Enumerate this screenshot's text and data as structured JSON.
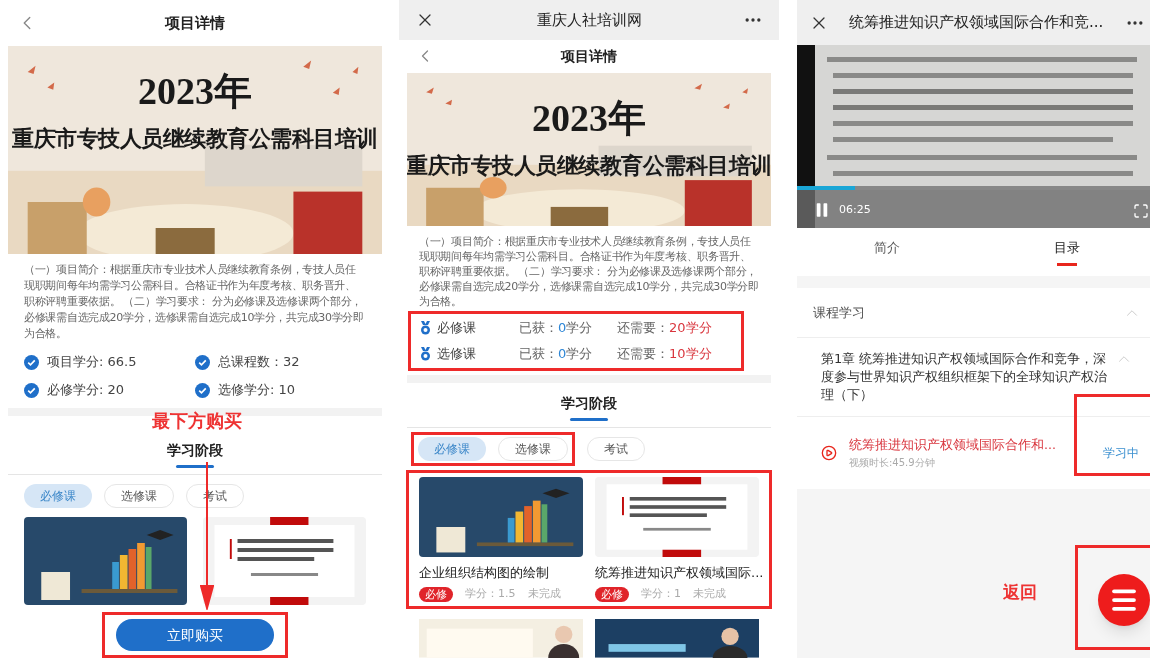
{
  "screen_1": {
    "header_title": "项目详情",
    "banner": {
      "year": "2023年",
      "title": "重庆市专技人员继续教育公需科目培训"
    },
    "description": "（一）项目简介：根据重庆市专业技术人员继续教育条例，专技人员任现职期间每年均需学习公需科目。合格证书作为年度考核、职务晋升、职称评聘重要依据。 （二）学习要求： 分为必修课及选修课两个部分，必修课需自选完成20学分，选修课需自选完成10学分，共完成30学分即为合格。",
    "stats": [
      "项目学分: 66.5",
      "总课程数：32",
      "必修学分: 20",
      "选修学分: 10"
    ],
    "annotation": "最下方购买",
    "section_title": "学习阶段",
    "filters": [
      {
        "label": "必修课",
        "selected": true
      },
      {
        "label": "选修课",
        "selected": false
      },
      {
        "label": "考试",
        "selected": false
      }
    ],
    "buy_button": "立即购买"
  },
  "screen_2": {
    "app_bar_title": "重庆人社培训网",
    "header_title": "项目详情",
    "banner": {
      "year": "2023年",
      "title": "重庆市专技人员继续教育公需科目培训"
    },
    "description": "（一）项目简介：根据重庆市专业技术人员继续教育条例，专技人员任现职期间每年均需学习公需科目。合格证书作为年度考核、职务晋升、职称评聘重要依据。 （二）学习要求： 分为必修课及选修课两个部分，必修课需自选完成20学分，选修课需自选完成10学分，共完成30学分即为合格。",
    "credits": [
      {
        "name": "必修课",
        "earned_label": "已获：",
        "earned": "0",
        "earned_unit": "学分",
        "need_label": "还需要：",
        "need": "20学分"
      },
      {
        "name": "选修课",
        "earned_label": "已获：",
        "earned": "0",
        "earned_unit": "学分",
        "need_label": "还需要：",
        "need": "10学分"
      }
    ],
    "section_title": "学习阶段",
    "filters": [
      {
        "label": "必修课",
        "selected": true
      },
      {
        "label": "选修课",
        "selected": false
      },
      {
        "label": "考试",
        "selected": false
      }
    ],
    "courses": [
      {
        "title": "企业组织结构图的绘制",
        "tag": "必修",
        "credit": "学分：1.5",
        "status": "未完成"
      },
      {
        "title": "统筹推进知识产权领域国际...",
        "tag": "必修",
        "credit": "学分：1",
        "status": "未完成"
      }
    ]
  },
  "screen_3": {
    "title": "统筹推进知识产权领域国际合作和竞...",
    "video": {
      "time": "06:25",
      "level": 0.16,
      "playing": true
    },
    "tabs": [
      {
        "label": "简介",
        "selected": false
      },
      {
        "label": "目录",
        "selected": true
      }
    ],
    "section": {
      "title": "课程学习",
      "expanded": true
    },
    "chapter": {
      "title": "第1章 统筹推进知识产权领域国际合作和竞争，深度参与世界知识产权组织框架下的全球知识产权治理（下）",
      "expanded": true
    },
    "lesson": {
      "title": "统筹推进知识产权领域国际合作和...",
      "duration": "视频时长:45.9分钟",
      "status": "学习中"
    },
    "annotation": "返回"
  }
}
